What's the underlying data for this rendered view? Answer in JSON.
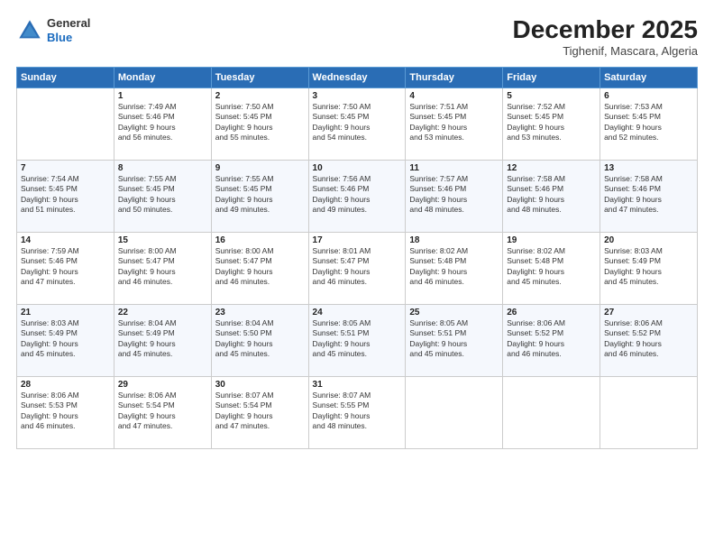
{
  "header": {
    "logo_line1": "General",
    "logo_line2": "Blue",
    "title": "December 2025",
    "location": "Tighenif, Mascara, Algeria"
  },
  "days_of_week": [
    "Sunday",
    "Monday",
    "Tuesday",
    "Wednesday",
    "Thursday",
    "Friday",
    "Saturday"
  ],
  "weeks": [
    [
      {
        "day": "",
        "detail": ""
      },
      {
        "day": "1",
        "detail": "Sunrise: 7:49 AM\nSunset: 5:46 PM\nDaylight: 9 hours\nand 56 minutes."
      },
      {
        "day": "2",
        "detail": "Sunrise: 7:50 AM\nSunset: 5:45 PM\nDaylight: 9 hours\nand 55 minutes."
      },
      {
        "day": "3",
        "detail": "Sunrise: 7:50 AM\nSunset: 5:45 PM\nDaylight: 9 hours\nand 54 minutes."
      },
      {
        "day": "4",
        "detail": "Sunrise: 7:51 AM\nSunset: 5:45 PM\nDaylight: 9 hours\nand 53 minutes."
      },
      {
        "day": "5",
        "detail": "Sunrise: 7:52 AM\nSunset: 5:45 PM\nDaylight: 9 hours\nand 53 minutes."
      },
      {
        "day": "6",
        "detail": "Sunrise: 7:53 AM\nSunset: 5:45 PM\nDaylight: 9 hours\nand 52 minutes."
      }
    ],
    [
      {
        "day": "7",
        "detail": "Sunrise: 7:54 AM\nSunset: 5:45 PM\nDaylight: 9 hours\nand 51 minutes."
      },
      {
        "day": "8",
        "detail": "Sunrise: 7:55 AM\nSunset: 5:45 PM\nDaylight: 9 hours\nand 50 minutes."
      },
      {
        "day": "9",
        "detail": "Sunrise: 7:55 AM\nSunset: 5:45 PM\nDaylight: 9 hours\nand 49 minutes."
      },
      {
        "day": "10",
        "detail": "Sunrise: 7:56 AM\nSunset: 5:46 PM\nDaylight: 9 hours\nand 49 minutes."
      },
      {
        "day": "11",
        "detail": "Sunrise: 7:57 AM\nSunset: 5:46 PM\nDaylight: 9 hours\nand 48 minutes."
      },
      {
        "day": "12",
        "detail": "Sunrise: 7:58 AM\nSunset: 5:46 PM\nDaylight: 9 hours\nand 48 minutes."
      },
      {
        "day": "13",
        "detail": "Sunrise: 7:58 AM\nSunset: 5:46 PM\nDaylight: 9 hours\nand 47 minutes."
      }
    ],
    [
      {
        "day": "14",
        "detail": "Sunrise: 7:59 AM\nSunset: 5:46 PM\nDaylight: 9 hours\nand 47 minutes."
      },
      {
        "day": "15",
        "detail": "Sunrise: 8:00 AM\nSunset: 5:47 PM\nDaylight: 9 hours\nand 46 minutes."
      },
      {
        "day": "16",
        "detail": "Sunrise: 8:00 AM\nSunset: 5:47 PM\nDaylight: 9 hours\nand 46 minutes."
      },
      {
        "day": "17",
        "detail": "Sunrise: 8:01 AM\nSunset: 5:47 PM\nDaylight: 9 hours\nand 46 minutes."
      },
      {
        "day": "18",
        "detail": "Sunrise: 8:02 AM\nSunset: 5:48 PM\nDaylight: 9 hours\nand 46 minutes."
      },
      {
        "day": "19",
        "detail": "Sunrise: 8:02 AM\nSunset: 5:48 PM\nDaylight: 9 hours\nand 45 minutes."
      },
      {
        "day": "20",
        "detail": "Sunrise: 8:03 AM\nSunset: 5:49 PM\nDaylight: 9 hours\nand 45 minutes."
      }
    ],
    [
      {
        "day": "21",
        "detail": "Sunrise: 8:03 AM\nSunset: 5:49 PM\nDaylight: 9 hours\nand 45 minutes."
      },
      {
        "day": "22",
        "detail": "Sunrise: 8:04 AM\nSunset: 5:49 PM\nDaylight: 9 hours\nand 45 minutes."
      },
      {
        "day": "23",
        "detail": "Sunrise: 8:04 AM\nSunset: 5:50 PM\nDaylight: 9 hours\nand 45 minutes."
      },
      {
        "day": "24",
        "detail": "Sunrise: 8:05 AM\nSunset: 5:51 PM\nDaylight: 9 hours\nand 45 minutes."
      },
      {
        "day": "25",
        "detail": "Sunrise: 8:05 AM\nSunset: 5:51 PM\nDaylight: 9 hours\nand 45 minutes."
      },
      {
        "day": "26",
        "detail": "Sunrise: 8:06 AM\nSunset: 5:52 PM\nDaylight: 9 hours\nand 46 minutes."
      },
      {
        "day": "27",
        "detail": "Sunrise: 8:06 AM\nSunset: 5:52 PM\nDaylight: 9 hours\nand 46 minutes."
      }
    ],
    [
      {
        "day": "28",
        "detail": "Sunrise: 8:06 AM\nSunset: 5:53 PM\nDaylight: 9 hours\nand 46 minutes."
      },
      {
        "day": "29",
        "detail": "Sunrise: 8:06 AM\nSunset: 5:54 PM\nDaylight: 9 hours\nand 47 minutes."
      },
      {
        "day": "30",
        "detail": "Sunrise: 8:07 AM\nSunset: 5:54 PM\nDaylight: 9 hours\nand 47 minutes."
      },
      {
        "day": "31",
        "detail": "Sunrise: 8:07 AM\nSunset: 5:55 PM\nDaylight: 9 hours\nand 48 minutes."
      },
      {
        "day": "",
        "detail": ""
      },
      {
        "day": "",
        "detail": ""
      },
      {
        "day": "",
        "detail": ""
      }
    ]
  ]
}
